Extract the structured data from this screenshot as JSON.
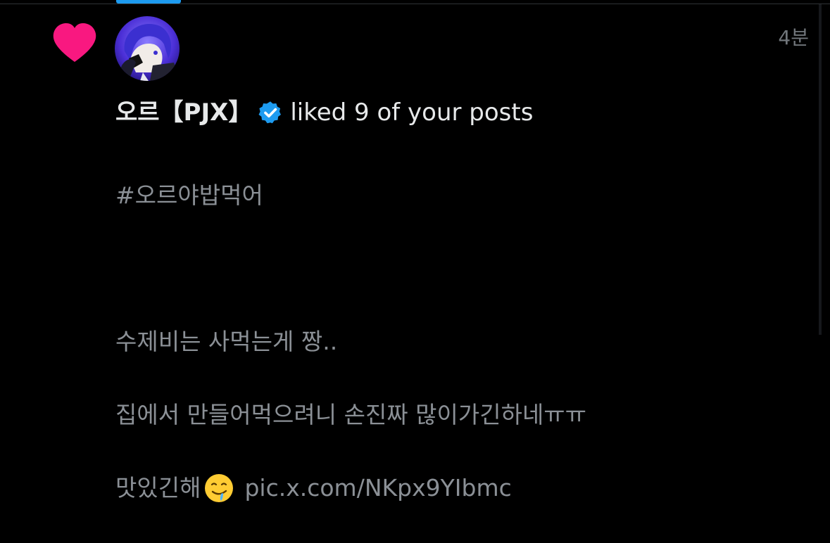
{
  "notification": {
    "timestamp": "4분",
    "user_name": "오르【PJX】",
    "action_text": "liked 9 of your posts",
    "post": {
      "lines": [
        "#오르야밥먹어",
        "",
        "수제비는 사먹는게 짱..",
        "집에서 만들어먹으려니 손진짜 많이가긴하네ㅠㅠ"
      ],
      "last_line_text": "맛있긴해",
      "emoji": "drooling-face-icon",
      "link": "pic.x.com/NKpx9YIbmc"
    }
  },
  "colors": {
    "background": "#000000",
    "heart": "#f91880",
    "verified": "#1d9bf0",
    "primary_text": "#e7e9ea",
    "secondary_text": "#71767b",
    "tab_indicator": "#1d9bf0"
  },
  "icons": {
    "like": "heart-icon",
    "verified": "verified-badge-icon",
    "avatar": "avatar"
  }
}
